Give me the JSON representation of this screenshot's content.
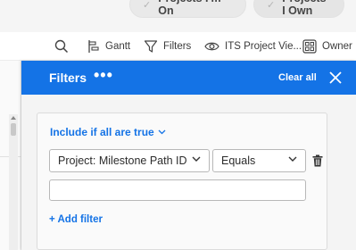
{
  "tabs": {
    "projects_on": "Projects I'm On",
    "projects_own": "Projects I Own"
  },
  "toolbar": {
    "gantt": "Gantt",
    "filters": "Filters",
    "view": "ITS Project Vie...",
    "owner": "Owner"
  },
  "panel": {
    "title": "Filters",
    "more": "•••",
    "clear_all": "Clear all",
    "include": "Include if all are true",
    "field": "Project: Milestone Path ID",
    "operator": "Equals",
    "value": "",
    "add_filter": "+ Add filter"
  },
  "colors": {
    "accent": "#1473e6",
    "header_bg": "#1473e6"
  },
  "icons": [
    "check-icon",
    "search-icon",
    "gantt-icon",
    "filter-icon",
    "eye-icon",
    "grid-icon",
    "more-icon",
    "close-icon",
    "chevron-down-icon",
    "trash-icon"
  ]
}
